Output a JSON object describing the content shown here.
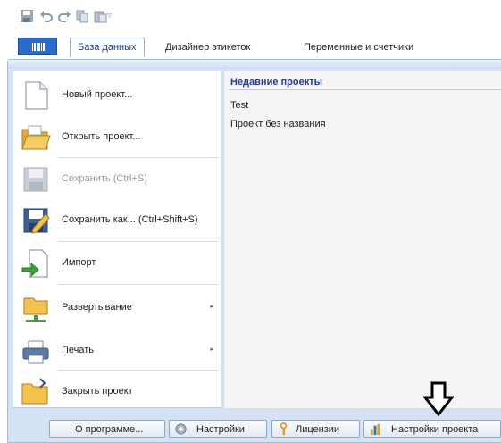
{
  "quick_access": {
    "items": [
      "save-icon",
      "undo-icon",
      "redo-icon",
      "copy-icon",
      "paste-icon"
    ],
    "customize_glyph": "▿"
  },
  "ribbon": {
    "tabs": [
      {
        "label": "База данных"
      },
      {
        "label": "Дизайнер этикеток"
      },
      {
        "label": "Переменные и счетчики"
      }
    ]
  },
  "menu": {
    "items": [
      {
        "label": "Новый проект...",
        "icon": "new-document-icon"
      },
      {
        "label": "Открыть проект...",
        "icon": "open-folder-icon"
      },
      {
        "label": "Сохранить (Ctrl+S)",
        "icon": "save-icon",
        "disabled": true
      },
      {
        "label": "Сохранить как... (Ctrl+Shift+S)",
        "icon": "save-as-icon"
      },
      {
        "label": "Импорт",
        "icon": "import-icon"
      },
      {
        "label": "Развертывание",
        "icon": "deploy-icon",
        "submenu": true
      },
      {
        "label": "Печать",
        "icon": "printer-icon",
        "submenu": true
      },
      {
        "label": "Закрыть проект",
        "icon": "close-project-icon"
      }
    ],
    "submenu_glyph": "▸"
  },
  "recent": {
    "title": "Недавние проекты",
    "items": [
      "Test",
      "Проект без названия"
    ]
  },
  "bottom": {
    "about": "О программе...",
    "settings": "Настройки",
    "licenses": "Лицензии",
    "project_settings": "Настройки проекта"
  },
  "colors": {
    "accent": "#2c6bc7",
    "frame": "#d4e2f4",
    "recent_title": "#2b3b8c"
  }
}
